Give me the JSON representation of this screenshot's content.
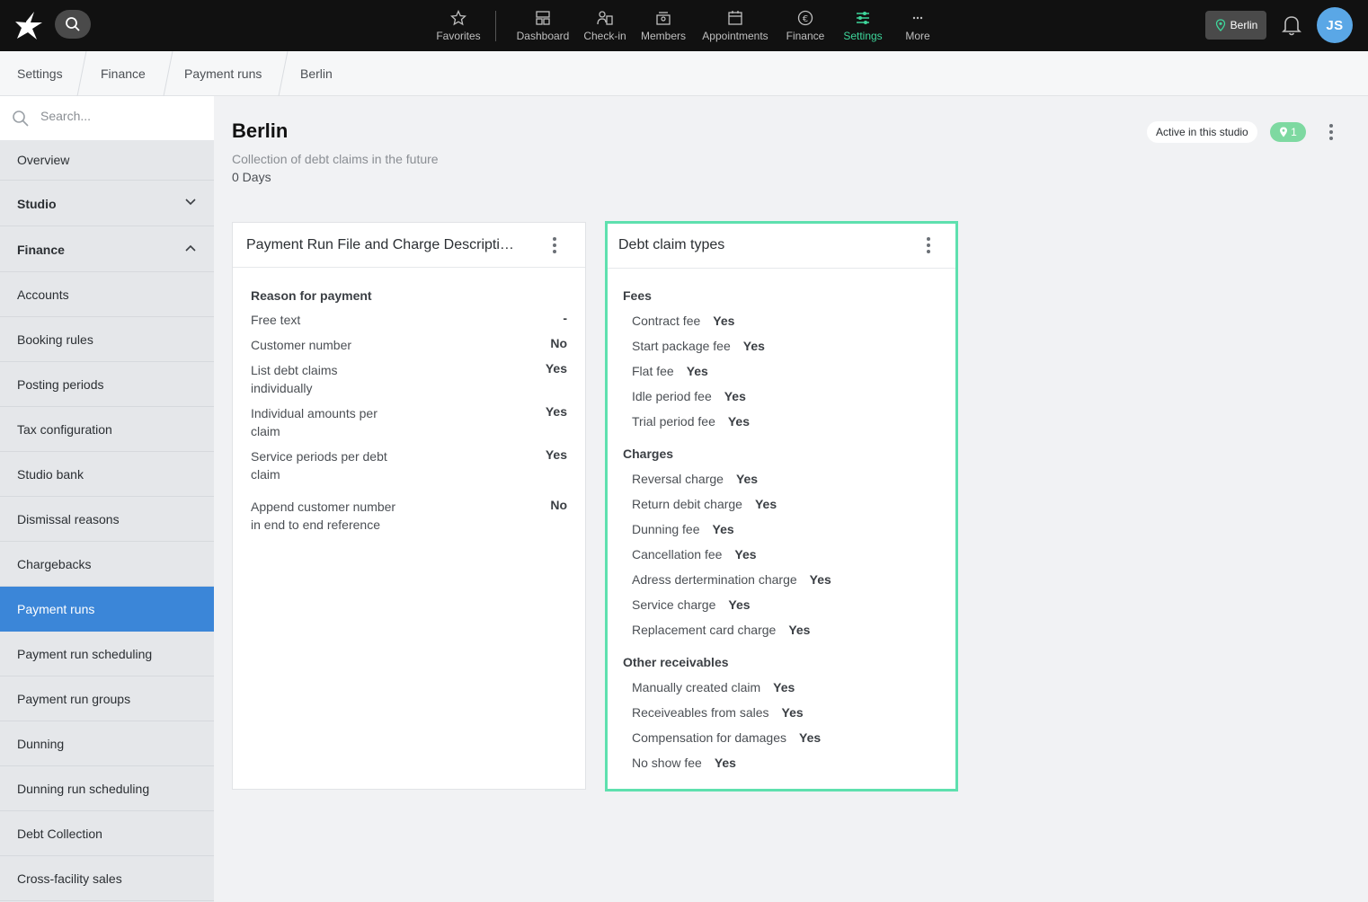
{
  "topbar": {
    "nav": [
      {
        "label": "Favorites",
        "icon": "star-icon"
      },
      {
        "label": "Dashboard",
        "icon": "dashboard-icon"
      },
      {
        "label": "Check-in",
        "icon": "check-in-icon"
      },
      {
        "label": "Members",
        "icon": "members-icon"
      },
      {
        "label": "Appointments",
        "icon": "calendar-icon"
      },
      {
        "label": "Finance",
        "icon": "euro-icon"
      },
      {
        "label": "Settings",
        "icon": "sliders-icon"
      },
      {
        "label": "More",
        "icon": "more-dots-icon"
      }
    ],
    "studio": "Berlin",
    "avatar_initials": "JS",
    "accent_color": "#3ed69b"
  },
  "breadcrumb": [
    "Settings",
    "Finance",
    "Payment runs",
    "Berlin"
  ],
  "sidebar": {
    "search_placeholder": "Search...",
    "items": [
      {
        "label": "Overview"
      },
      {
        "label": "Studio"
      },
      {
        "label": "Finance"
      },
      {
        "label": "Accounts"
      },
      {
        "label": "Booking rules"
      },
      {
        "label": "Posting periods"
      },
      {
        "label": "Tax configuration"
      },
      {
        "label": "Studio bank"
      },
      {
        "label": "Dismissal reasons"
      },
      {
        "label": "Chargebacks"
      },
      {
        "label": "Payment runs"
      },
      {
        "label": "Payment run scheduling"
      },
      {
        "label": "Payment run groups"
      },
      {
        "label": "Dunning"
      },
      {
        "label": "Dunning run scheduling"
      },
      {
        "label": "Debt Collection"
      },
      {
        "label": "Cross-facility sales"
      }
    ],
    "active_color": "#3b86d8"
  },
  "main": {
    "title": "Berlin",
    "subtitle": "Collection of debt claims in the future",
    "days": "0 Days",
    "active_label": "Active in this studio",
    "studio_count": "1"
  },
  "card1": {
    "title": "Payment Run File and Charge Descripti…",
    "heading": "Reason for payment",
    "rows": [
      {
        "label1": "Free text",
        "label2": "",
        "value": "-"
      },
      {
        "label1": "Customer number",
        "label2": "",
        "value": "No"
      },
      {
        "label1": "List debt claims",
        "label2": "individually",
        "value": "Yes"
      },
      {
        "label1": "Individual amounts per",
        "label2": "claim",
        "value": "Yes"
      },
      {
        "label1": "Service periods per debt",
        "label2": "claim",
        "value": "Yes"
      },
      {
        "label1": "Append customer number",
        "label2": "in end to end reference",
        "value": "No"
      }
    ]
  },
  "card2": {
    "title": "Debt claim types",
    "groups": [
      {
        "heading": "Fees",
        "items": [
          {
            "label": "Contract fee",
            "value": "Yes"
          },
          {
            "label": "Start package fee",
            "value": "Yes"
          },
          {
            "label": "Flat fee",
            "value": "Yes"
          },
          {
            "label": "Idle period fee",
            "value": "Yes"
          },
          {
            "label": "Trial period fee",
            "value": "Yes"
          }
        ]
      },
      {
        "heading": "Charges",
        "items": [
          {
            "label": "Reversal charge",
            "value": "Yes"
          },
          {
            "label": "Return debit charge",
            "value": "Yes"
          },
          {
            "label": "Dunning fee",
            "value": "Yes"
          },
          {
            "label": "Cancellation fee",
            "value": "Yes"
          },
          {
            "label": "Adress dertermination charge",
            "value": "Yes"
          },
          {
            "label": "Service charge",
            "value": "Yes"
          },
          {
            "label": "Replacement card charge",
            "value": "Yes"
          }
        ]
      },
      {
        "heading": "Other receivables",
        "items": [
          {
            "label": "Manually created claim",
            "value": "Yes"
          },
          {
            "label": "Receiveables from sales",
            "value": "Yes"
          },
          {
            "label": "Compensation for damages",
            "value": "Yes"
          },
          {
            "label": "No show fee",
            "value": "Yes"
          }
        ]
      }
    ],
    "highlight_color": "#5ee0ae"
  }
}
